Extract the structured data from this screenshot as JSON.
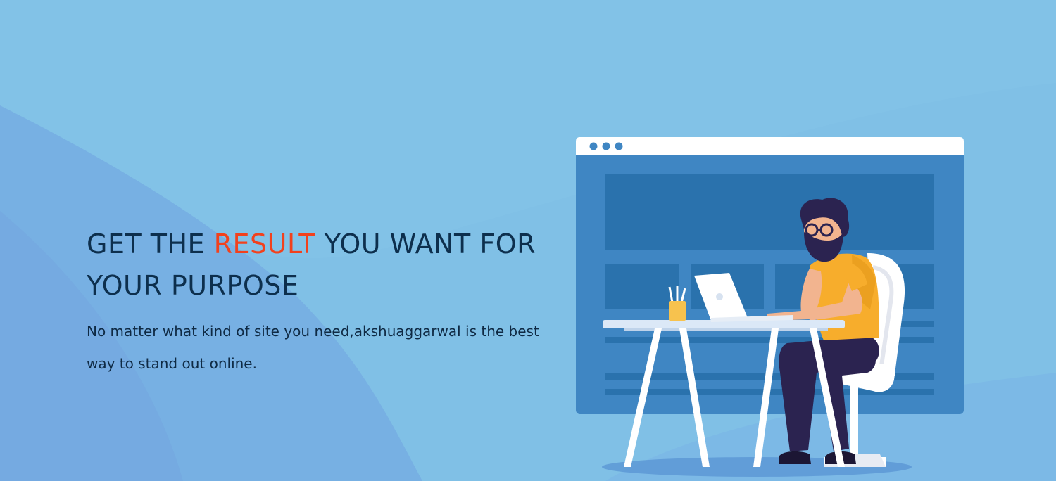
{
  "hero": {
    "headline_part1": "GET THE ",
    "headline_accent": "RESULT",
    "headline_part2": " YOU WANT FOR YOUR PURPOSE",
    "subtext": "No matter what kind of site you need,akshuaggarwal is the best way to stand out online."
  },
  "colors": {
    "background": "#7fbfe6",
    "heading": "#0d2f4d",
    "accent": "#f2411d",
    "window_panel": "#3f86c3",
    "window_bar": "#ffffff",
    "shirt": "#f7ad2c"
  },
  "illustration": {
    "icon_name": "developer-at-desk-illustration"
  }
}
